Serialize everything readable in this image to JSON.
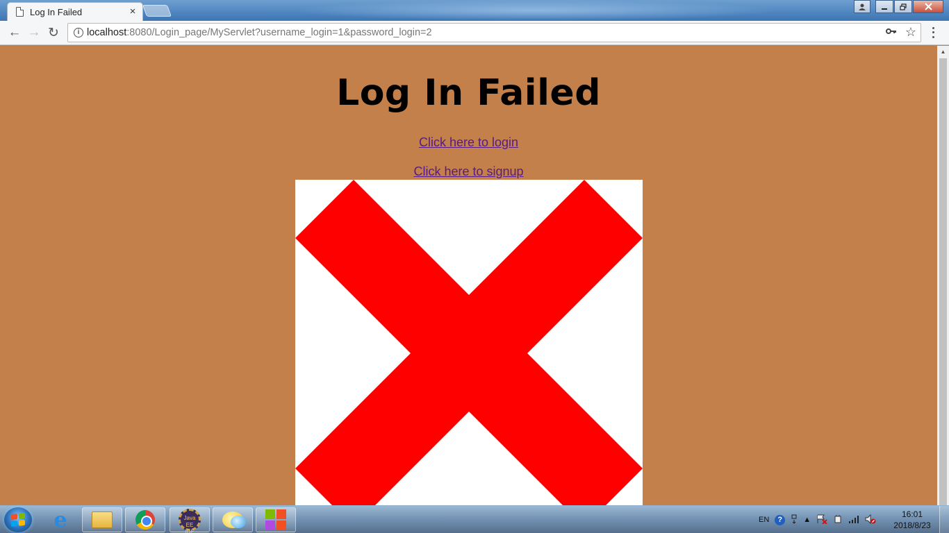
{
  "browser": {
    "tab_title": "Log In Failed",
    "tab_close": "×",
    "url_host": "localhost",
    "url_rest": ":8080/Login_page/MyServlet?username_login=1&password_login=2",
    "nav": {
      "back": "←",
      "forward": "→",
      "reload": "↻"
    },
    "icons": {
      "info": "i",
      "key": "⚿",
      "star": "☆"
    }
  },
  "page": {
    "title": "Log In Failed",
    "login_link": "Click here to login",
    "signup_link": "Click here to signup",
    "image": {
      "name": "red-x-image",
      "colors": {
        "cross": "#ff0000",
        "background": "#ffffff"
      }
    },
    "background_color": "#c4804a",
    "link_color": "#551a8b"
  },
  "taskbar": {
    "items": [
      "start-button",
      "internet-explorer-icon",
      "file-explorer-icon",
      "chrome-icon",
      "java-ee-ide-icon",
      "messenger-icon",
      "tiles-app-icon"
    ],
    "javaee_label": "Java EE IDE",
    "tray": {
      "language": "EN",
      "help": "?",
      "expand": "▲"
    },
    "clock": {
      "time": "16:01",
      "date": "2018/8/23"
    }
  }
}
